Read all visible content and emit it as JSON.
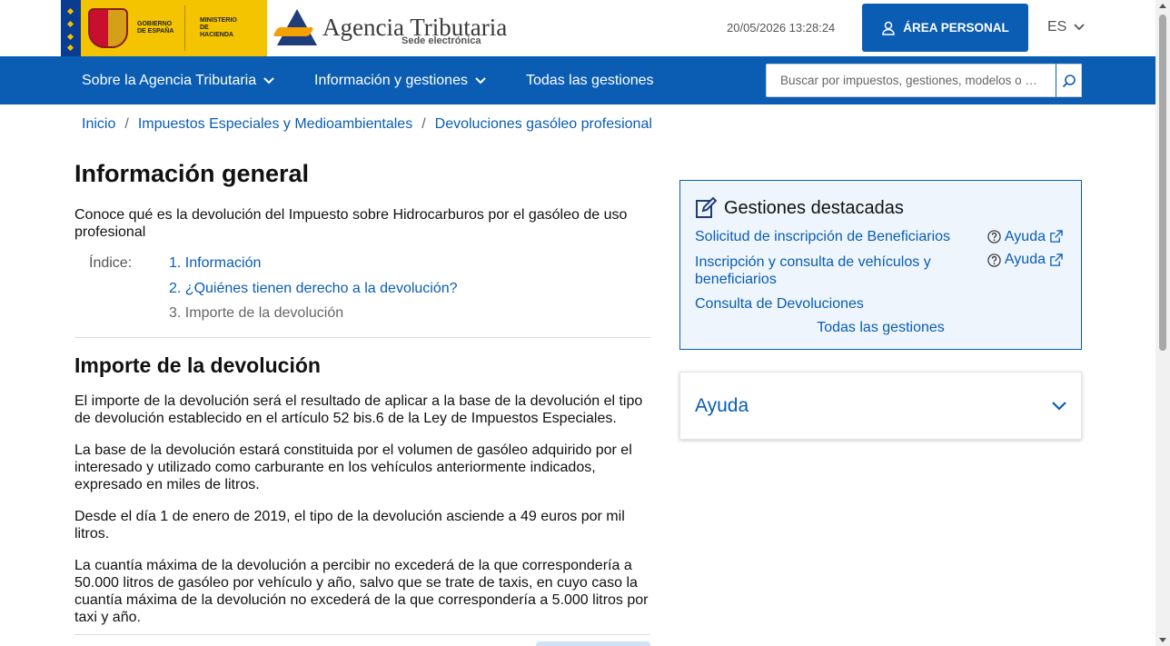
{
  "header": {
    "gov_text_1": "Gobierno de España",
    "gov_text_2": "Ministerio de Hacienda",
    "agency_name": "Agencia Tributaria",
    "agency_sub": "Sede electrónica",
    "datetime": "20/05/2026 13:28:24",
    "area_personal": "ÁREA PERSONAL",
    "language": "ES"
  },
  "nav": {
    "items": [
      {
        "label": "Sobre la Agencia Tributaria",
        "dropdown": true
      },
      {
        "label": "Información y gestiones",
        "dropdown": true
      },
      {
        "label": "Todas las gestiones",
        "dropdown": false
      }
    ],
    "search_placeholder": "Buscar por impuestos, gestiones, modelos o …"
  },
  "breadcrumb": [
    "Inicio",
    "Impuestos Especiales y Medioambientales",
    "Devoluciones gasóleo profesional"
  ],
  "main": {
    "title": "Información general",
    "intro": "Conoce qué es la devolución del Impuesto sobre Hidrocarburos por el gasóleo de uso profesional",
    "index_label": "Índice:",
    "index": [
      {
        "label": "1. Información",
        "current": false
      },
      {
        "label": "2. ¿Quiénes tienen derecho a la devolución?",
        "current": false
      },
      {
        "label": "3. Importe de la devolución",
        "current": true
      }
    ],
    "section_title": "Importe de la devolución",
    "paragraphs": [
      "El importe de la devolución será el resultado de aplicar a la base de la devolución el tipo de devolución establecido en el artículo 52 bis.6 de la Ley de Impuestos Especiales.",
      "La base de la devolución estará constituida por el volumen de gasóleo adquirido por el interesado y utilizado como carburante en los vehículos anteriormente indicados, expresado en miles de litros.",
      "Desde el día 1 de enero de 2019, el tipo de la devolución asciende a 49 euros por mil litros.",
      "La cuantía máxima de la devolución a percibir no excederá de la que correspondería a 50.000 litros de gasóleo por vehículo y año, salvo que se trate de taxis, en cuyo caso la cuantía máxima de la devolución no excederá de la que correspondería a 5.000 litros por taxi y año."
    ]
  },
  "sidebar": {
    "featured_title": "Gestiones destacadas",
    "items": [
      {
        "label": "Solicitud de inscripción de Beneficiarios",
        "help": "Ayuda"
      },
      {
        "label": "Inscripción y consulta de vehículos y beneficiarios",
        "help": "Ayuda"
      },
      {
        "label": "Consulta de Devoluciones",
        "help": ""
      }
    ],
    "all_label": "Todas las gestiones",
    "ayuda_title": "Ayuda"
  },
  "colors": {
    "primary": "#0a5db3",
    "featured_bg": "#eef5fc",
    "gov_yellow": "#f4c400"
  }
}
